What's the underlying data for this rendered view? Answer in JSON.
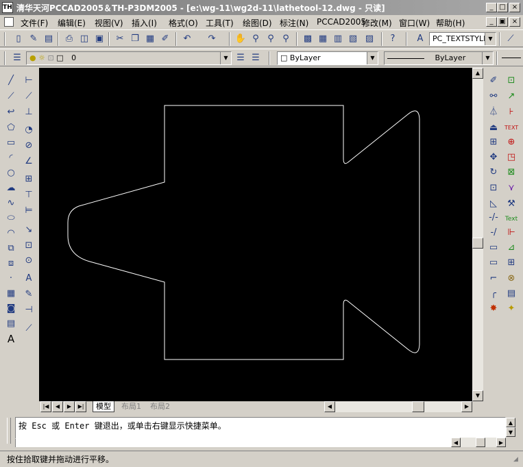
{
  "window": {
    "title": "清华天河PCCAD2005＆TH-P3DM2005 - [e:\\wg-11\\wg2d-11\\lathetool-12.dwg - 只读]",
    "app_icon_text": "TH",
    "buttons": [
      "_",
      "□",
      "×"
    ],
    "doc_buttons": [
      "_",
      "▣",
      "×"
    ]
  },
  "menu": {
    "items": [
      "文件(F)",
      "编辑(E)",
      "视图(V)",
      "插入(I)",
      "格式(O)",
      "工具(T)",
      "绘图(D)",
      "标注(N)",
      "PCCAD2005",
      "修改(M)",
      "窗口(W)",
      "帮助(H)"
    ]
  },
  "toolbar1": {
    "text_style": "PC_TEXTSTYLE"
  },
  "toolbar2": {
    "layer_value": "0",
    "color_value": "ByLayer",
    "linetype_value": "ByLayer"
  },
  "tabs": {
    "model": "模型",
    "layout1": "布局1",
    "layout2": "布局2"
  },
  "command": {
    "prompt": "按 Esc 或 Enter 键退出，或单击右键显示快捷菜单。"
  },
  "status": {
    "text": "按住拾取键并拖动进行平移。"
  },
  "colors": {
    "canvas": "#000000",
    "drawing_line": "#ffffff",
    "chrome": "#d4d0c8"
  }
}
